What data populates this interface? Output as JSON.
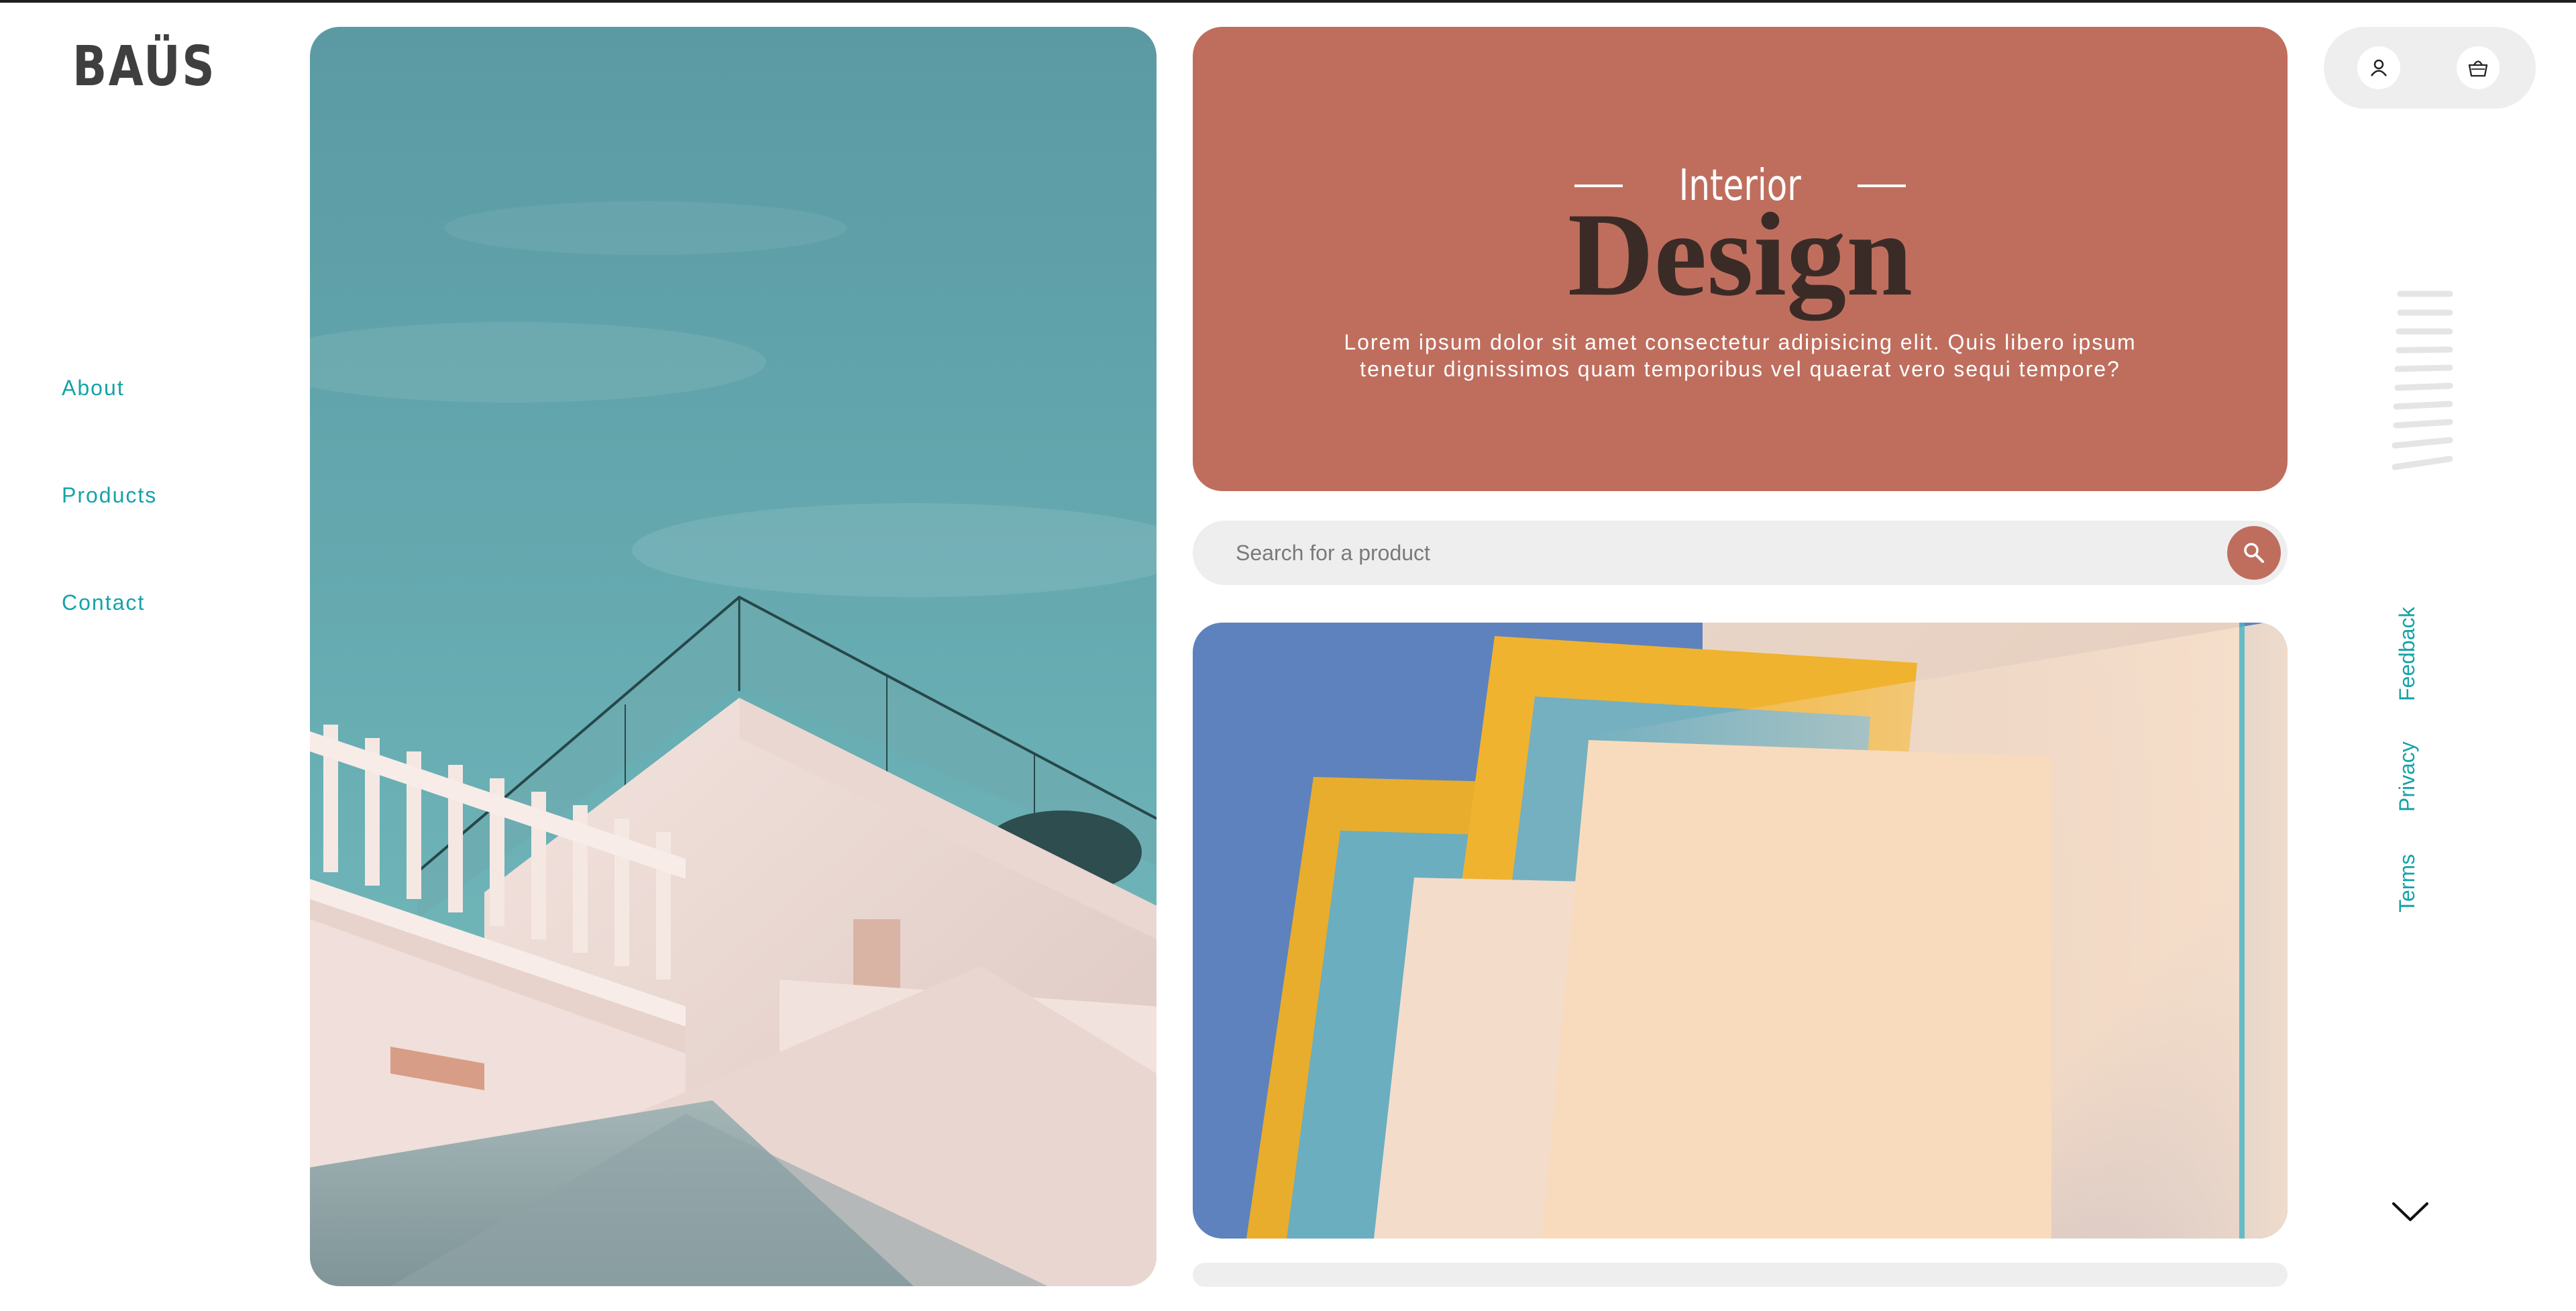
{
  "brand": {
    "logo": "BAÜS"
  },
  "nav": {
    "items": [
      "About",
      "Products",
      "Contact"
    ]
  },
  "hero": {
    "eyebrow": "Interior",
    "title": "Design",
    "description": "Lorem ipsum dolor sit amet consectetur adipisicing elit. Quis libero ipsum tenetur dignissimos quam temporibus vel quaerat vero sequi tempore?"
  },
  "search": {
    "placeholder": "Search for a product",
    "button_icon": "search-icon"
  },
  "header": {
    "icons": [
      "user-icon",
      "basket-icon"
    ]
  },
  "footer_links": [
    "Feedback",
    "Privacy",
    "Terms"
  ],
  "images": {
    "left": "white-building-staircase-photo",
    "right": "abstract-overlapping-sheets-photo"
  },
  "colors": {
    "accent_teal": "#14a3a8",
    "terracotta": "#bf6e5e",
    "title_dark": "#3b2b27",
    "panel_gray": "#eeeeee"
  }
}
